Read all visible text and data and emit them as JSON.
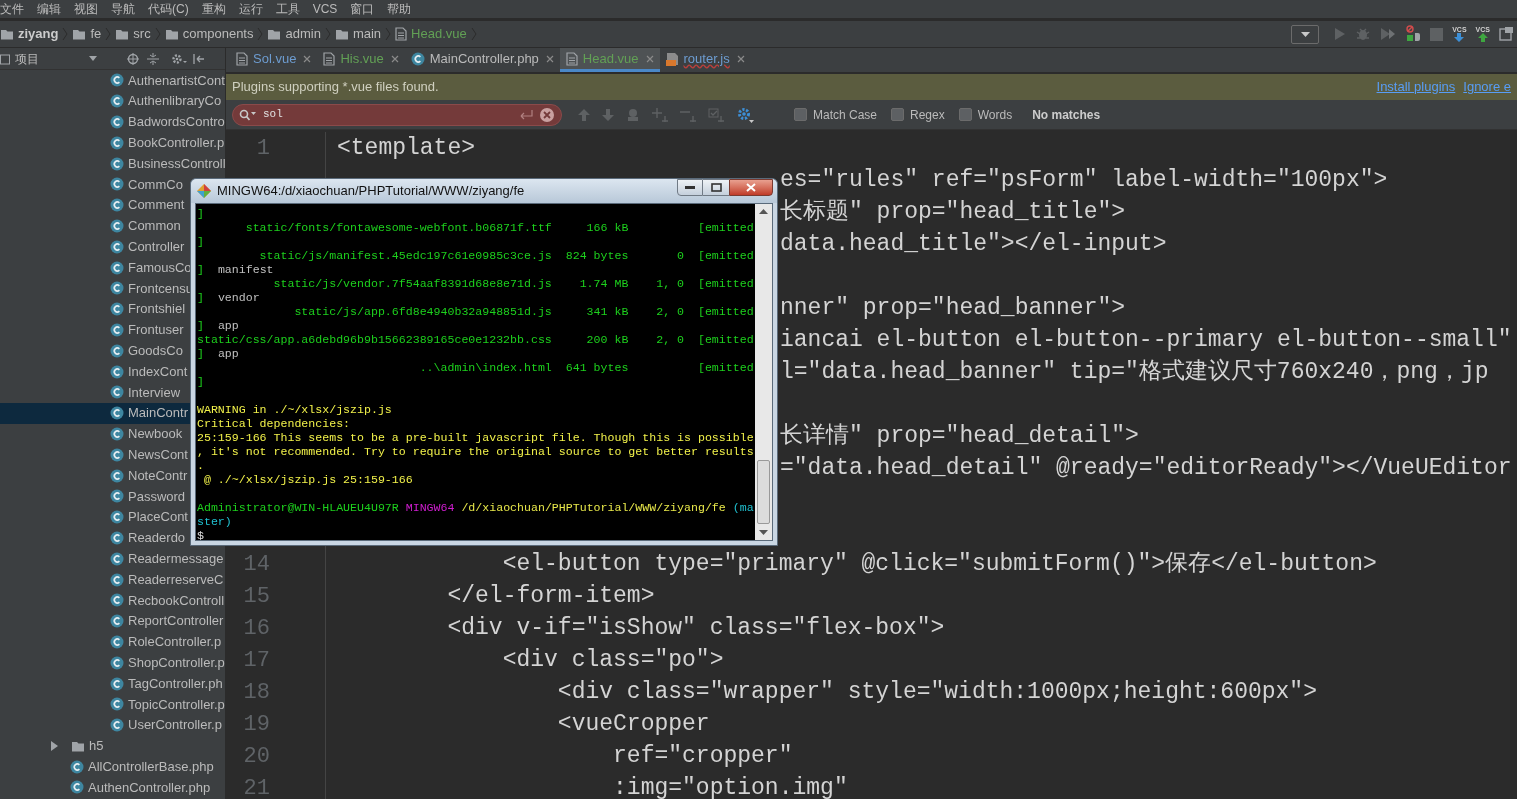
{
  "menu_bar": [
    "文件",
    "编辑",
    "视图",
    "导航",
    "代码(C)",
    "重构",
    "运行",
    "工具",
    "VCS",
    "窗口",
    "帮助"
  ],
  "breadcrumb": [
    {
      "label": "ziyang",
      "kind": "project"
    },
    {
      "label": "fe",
      "kind": "folder"
    },
    {
      "label": "src",
      "kind": "folder"
    },
    {
      "label": "components",
      "kind": "folder"
    },
    {
      "label": "admin",
      "kind": "folder"
    },
    {
      "label": "main",
      "kind": "folder"
    },
    {
      "label": "Head.vue",
      "kind": "file"
    }
  ],
  "toolbar": [
    {
      "kind": "dropdown"
    },
    {
      "kind": "run"
    },
    {
      "kind": "debug"
    },
    {
      "kind": "coverage"
    },
    {
      "kind": "profile"
    },
    {
      "kind": "stop"
    },
    {
      "kind": "vcs-update",
      "label": "VCS"
    },
    {
      "kind": "vcs-commit",
      "label": "VCS"
    },
    {
      "kind": "window"
    }
  ],
  "project_panel": {
    "title": "项目",
    "tree": [
      {
        "kind": "group",
        "children": [
          {
            "label": "AuthenartistCont",
            "selected": false
          },
          {
            "label": "AuthenlibraryCo",
            "selected": false
          },
          {
            "label": "BadwordsContro",
            "selected": false
          },
          {
            "label": "BookController.p",
            "selected": false
          },
          {
            "label": "BusinessControll",
            "selected": false
          },
          {
            "label": "CommCo",
            "selected": false
          },
          {
            "label": "Comment",
            "selected": false
          },
          {
            "label": "Common",
            "selected": false
          },
          {
            "label": "Controller",
            "selected": false
          },
          {
            "label": "FamousCo",
            "selected": false
          },
          {
            "label": "Frontcensu",
            "selected": false
          },
          {
            "label": "Frontshiel",
            "selected": false
          },
          {
            "label": "Frontuser",
            "selected": false
          },
          {
            "label": "GoodsCo",
            "selected": false
          },
          {
            "label": "IndexCont",
            "selected": false
          },
          {
            "label": "Interview",
            "selected": false
          },
          {
            "label": "MainContr",
            "selected": true
          },
          {
            "label": "Newbook",
            "selected": false
          },
          {
            "label": "NewsCont",
            "selected": false
          },
          {
            "label": "NoteContr",
            "selected": false
          },
          {
            "label": "Password",
            "selected": false
          },
          {
            "label": "PlaceCont",
            "selected": false
          },
          {
            "label": "Readerdo",
            "selected": false
          },
          {
            "label": "Readermessage",
            "selected": false
          },
          {
            "label": "ReaderreserveC",
            "selected": false
          },
          {
            "label": "RecbookControll",
            "selected": false
          },
          {
            "label": "ReportController",
            "selected": false
          },
          {
            "label": "RoleController.p",
            "selected": false
          },
          {
            "label": "ShopController.p",
            "selected": false
          },
          {
            "label": "TagController.ph",
            "selected": false
          },
          {
            "label": "TopicController.p",
            "selected": false
          },
          {
            "label": "UserController.p",
            "selected": false
          }
        ]
      },
      {
        "kind": "folder",
        "label": "h5",
        "expanded": false,
        "selected": false
      },
      {
        "kind": "file",
        "label": "AllControllerBase.php",
        "selected": false
      },
      {
        "kind": "file",
        "label": "AuthenController.php",
        "selected": false
      }
    ]
  },
  "tabs": [
    {
      "label": "Sol.vue",
      "kind": "vue",
      "color": "#6d9cd0",
      "selected": false,
      "has_errors": false
    },
    {
      "label": "His.vue",
      "kind": "vue",
      "color": "#62a055",
      "selected": false,
      "has_errors": false
    },
    {
      "label": "MainController.php",
      "kind": "php",
      "color": "#bbbbbb",
      "selected": false,
      "has_errors": false
    },
    {
      "label": "Head.vue",
      "kind": "vue",
      "color": "#62a055",
      "selected": true,
      "has_errors": false
    },
    {
      "label": "router.js",
      "kind": "js",
      "color": "#6d9cd0",
      "selected": false,
      "has_errors": true
    }
  ],
  "notification": {
    "text": "Plugins supporting *.vue files found.",
    "links": [
      "Install plugins",
      "Ignore e"
    ]
  },
  "search": {
    "value": "sol",
    "no_matches": true,
    "options": [
      {
        "label": "Match Case",
        "checked": false
      },
      {
        "label": "Regex",
        "checked": false
      },
      {
        "label": "Words",
        "checked": false
      }
    ],
    "status": "No matches"
  },
  "editor": {
    "lines": [
      {
        "kind": "full",
        "number": "1",
        "text": "<template>"
      },
      {
        "kind": "fragment",
        "text": "es=\"rules\" ref=\"psForm\" label-width=\"100px\">"
      },
      {
        "kind": "fragment",
        "text": "长标题\" prop=\"head_title\">"
      },
      {
        "kind": "fragment",
        "text": "data.head_title\"></el-input>"
      },
      {
        "kind": "covered"
      },
      {
        "kind": "fragment",
        "text": "nner\" prop=\"head_banner\">"
      },
      {
        "kind": "fragment",
        "text": "iancai el-button el-button--primary el-button--small\""
      },
      {
        "kind": "fragment",
        "text": "l=\"data.head_banner\" tip=\"格式建议尺寸760x240，png，jp"
      },
      {
        "kind": "covered"
      },
      {
        "kind": "fragment",
        "text": "长详情\" prop=\"head_detail\">"
      },
      {
        "kind": "fragment",
        "text": "=\"data.head_detail\" @ready=\"editorReady\"></VueUEditor"
      },
      {
        "kind": "covered"
      },
      {
        "kind": "covered"
      },
      {
        "kind": "full",
        "number": "14",
        "text": "            <el-button type=\"primary\" @click=\"submitForm()\">保存</el-button>"
      },
      {
        "kind": "full",
        "number": "15",
        "text": "        </el-form-item>"
      },
      {
        "kind": "full",
        "number": "16",
        "text": "        <div v-if=\"isShow\" class=\"flex-box\">"
      },
      {
        "kind": "full",
        "number": "17",
        "text": "            <div class=\"po\">"
      },
      {
        "kind": "full",
        "number": "18",
        "text": "                <div class=\"wrapper\" style=\"width:1000px;height:600px\">"
      },
      {
        "kind": "full",
        "number": "19",
        "text": "                <vueCropper"
      },
      {
        "kind": "full",
        "number": "20",
        "text": "                    ref=\"cropper\""
      },
      {
        "kind": "full",
        "number": "21",
        "text": "                    :img=\"option.img\""
      }
    ]
  },
  "terminal": {
    "title": "MINGW64:/d/xiaochuan/PHPTutorial/WWW/ziyang/fe",
    "blocks": [
      [
        [
          {
            "text": "]",
            "kind": "emitted"
          }
        ],
        [
          {
            "text": "       static/fonts/fontawesome-webfont.b06871f.ttf     166 kB          [emitted",
            "kind": "emitted"
          }
        ],
        [
          {
            "text": "]",
            "kind": "emitted"
          }
        ],
        [
          {
            "text": "         static/js/manifest.45edc197c61e0985c3ce.js  824 bytes       0  [emitted",
            "kind": "emitted"
          }
        ],
        [
          {
            "text": "]",
            "kind": "emitted"
          },
          {
            "text": "  manifest",
            "kind": "chunk"
          }
        ],
        [
          {
            "text": "           static/js/vendor.7f54aaf8391d68e8e71d.js    1.74 MB    1, 0  [emitted",
            "kind": "emitted"
          }
        ],
        [
          {
            "text": "]",
            "kind": "emitted"
          },
          {
            "text": "  vendor",
            "kind": "chunk"
          }
        ],
        [
          {
            "text": "              static/js/app.6fd8e4940b32a948851d.js     341 kB    2, 0  [emitted",
            "kind": "emitted"
          }
        ],
        [
          {
            "text": "]",
            "kind": "emitted"
          },
          {
            "text": "  app",
            "kind": "chunk"
          }
        ],
        [
          {
            "text": "static/css/app.a6debd96b9b15662389165ce0e1232bb.css     200 kB    2, 0  [emitted",
            "kind": "emitted"
          }
        ],
        [
          {
            "text": "]",
            "kind": "emitted"
          },
          {
            "text": "  app",
            "kind": "chunk"
          }
        ],
        [
          {
            "text": "                                ..\\admin\\index.html  641 bytes          [emitted",
            "kind": "emitted"
          }
        ],
        [
          {
            "text": "]",
            "kind": "emitted"
          }
        ]
      ],
      [
        [
          {
            "text": "WARNING in ./~/xlsx/jszip.js",
            "kind": "warning"
          }
        ],
        [
          {
            "text": "Critical dependencies:",
            "kind": "warning"
          }
        ],
        [
          {
            "text": "25:159-166 This seems to be a pre-built javascript file. Though this is possible",
            "kind": "warning"
          }
        ],
        [
          {
            "text": ", it's not recommended. Try to require the original source to get better results",
            "kind": "warning"
          }
        ],
        [
          {
            "text": ".",
            "kind": "warning"
          }
        ],
        [
          {
            "text": " @ ./~/xlsx/jszip.js 25:159-166",
            "kind": "warning"
          }
        ]
      ],
      [
        [
          {
            "text": "Administrator@WIN-HLAUEU4U97R",
            "kind": "user"
          },
          {
            "text": " MINGW64",
            "kind": "shell"
          },
          {
            "text": " /d/xiaochuan/PHPTutorial/WWW/ziyang/fe",
            "kind": "cwd"
          },
          {
            "text": " (ma",
            "kind": "branch"
          }
        ],
        [
          {
            "text": "ster)",
            "kind": "branch"
          }
        ],
        [
          {
            "text": "$",
            "kind": "prompt"
          }
        ]
      ]
    ]
  }
}
